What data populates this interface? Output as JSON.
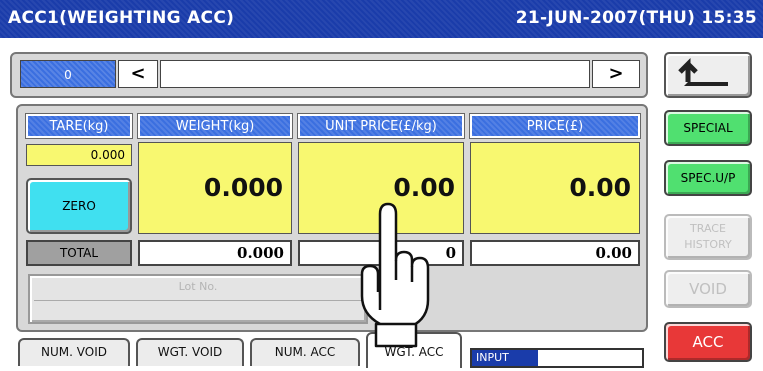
{
  "title": {
    "left": "ACC1(WEIGHTING ACC)",
    "right": "21-JUN-2007(THU) 15:35"
  },
  "nav": {
    "index_value": "0",
    "prev": "<",
    "next": ">"
  },
  "table": {
    "headers": {
      "tare": "TARE(kg)",
      "weight": "WEIGHT(kg)",
      "unit_price": "UNIT PRICE(£/kg)",
      "price": "PRICE(£)"
    },
    "tare_value": "0.000",
    "zero_label": "ZERO",
    "weight": "0.000",
    "unit_price": "0.00",
    "price": "0.00",
    "total_label": "TOTAL",
    "total_weight": "0.000",
    "total_count": "0",
    "total_price": "0.00",
    "lot_placeholder": "Lot No."
  },
  "tabs": [
    "NUM. VOID",
    "WGT. VOID",
    "NUM. ACC",
    "WGT. ACC"
  ],
  "active_tab": "WGT. ACC",
  "input_label": "INPUT",
  "side": {
    "special": "SPECIAL",
    "spec_up": "SPEC.U/P",
    "trace_line1": "TRACE",
    "trace_line2": "HISTORY",
    "void": "VOID",
    "acc": "ACC"
  },
  "colors": {
    "title_bg": "#1a3caa",
    "header_bg": "#3b6fe0",
    "field_yellow": "#f8f870",
    "zero_cyan": "#40e0f0",
    "special_green": "#50e070",
    "acc_red": "#e83838"
  }
}
